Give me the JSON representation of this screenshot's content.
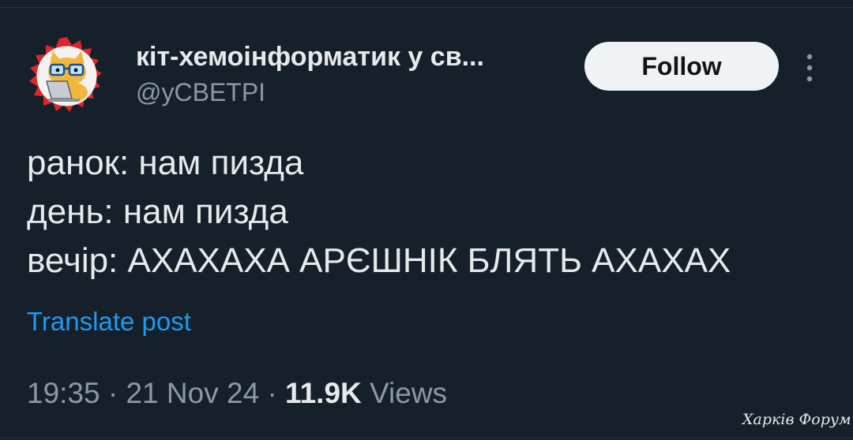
{
  "author": {
    "display_name": "кіт-хемоінформатик у св...",
    "handle": "@уСВЕТРІ",
    "avatar_icon": "cat-with-glasses-laptop-avatar"
  },
  "actions": {
    "follow_label": "Follow",
    "more_icon": "more-vertical-icon"
  },
  "tweet": {
    "lines": [
      "ранок: нам пизда",
      "день: нам пизда",
      "вечір: АХАХАХА АРЄШНІК БЛЯТЬ АХАХАХ"
    ],
    "translate_label": "Translate post"
  },
  "meta": {
    "time": "19:35",
    "separator": "·",
    "date": "21 Nov 24",
    "views_count": "11.9K",
    "views_label": "Views"
  },
  "watermark": "Харків Форум",
  "colors": {
    "background": "#15202b",
    "text": "#e7e9ea",
    "secondary": "#8b98a5",
    "link": "#1d9bf0",
    "button": "#eff3f4"
  }
}
